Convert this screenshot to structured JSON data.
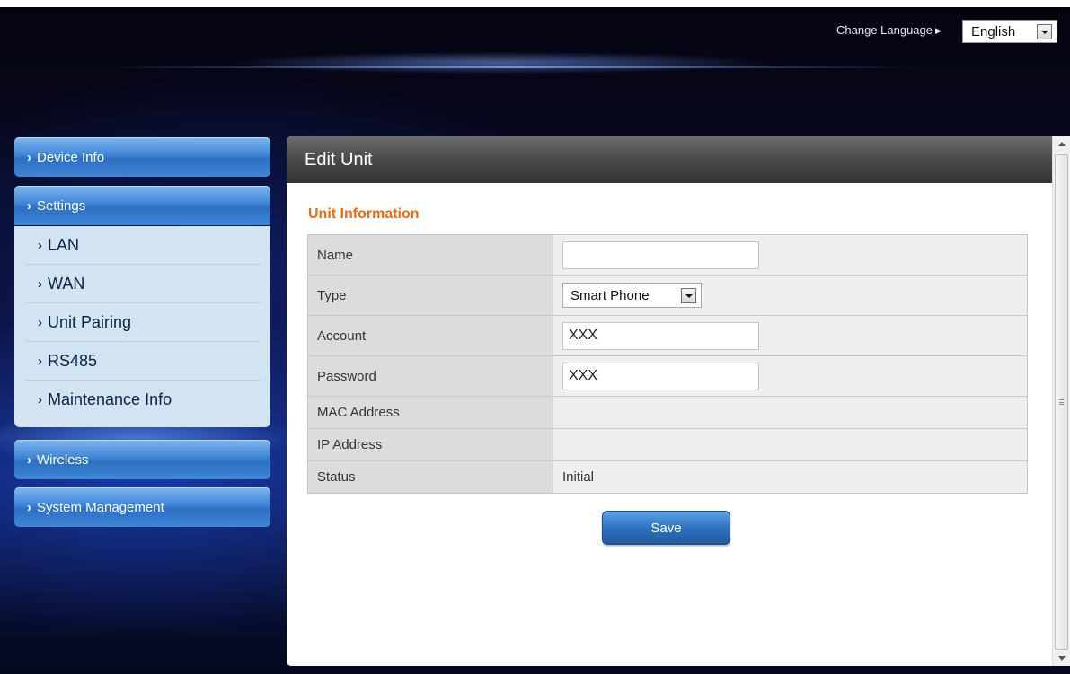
{
  "header": {
    "change_language_label": "Change Language",
    "language": {
      "selected": "English"
    }
  },
  "sidebar": {
    "items": [
      {
        "label": "Device Info"
      },
      {
        "label": "Settings"
      },
      {
        "label": "Wireless"
      },
      {
        "label": "System Management"
      }
    ],
    "settings_subitems": [
      {
        "label": "LAN"
      },
      {
        "label": "WAN"
      },
      {
        "label": "Unit Pairing"
      },
      {
        "label": "RS485"
      },
      {
        "label": "Maintenance Info"
      }
    ]
  },
  "main": {
    "title": "Edit Unit",
    "section_title": "Unit Information",
    "fields": {
      "name": {
        "label": "Name",
        "value": ""
      },
      "type": {
        "label": "Type",
        "value": "Smart Phone"
      },
      "account": {
        "label": "Account",
        "value": "XXX"
      },
      "password": {
        "label": "Password",
        "value": "XXX"
      },
      "mac": {
        "label": "MAC Address",
        "value": ""
      },
      "ip": {
        "label": "IP Address",
        "value": ""
      },
      "status": {
        "label": "Status",
        "value": "Initial"
      }
    },
    "save_label": "Save"
  },
  "colors": {
    "accent_orange": "#f06a0c",
    "menu_blue": "#3f85d6",
    "submenu_bg": "#d2e3f2"
  }
}
